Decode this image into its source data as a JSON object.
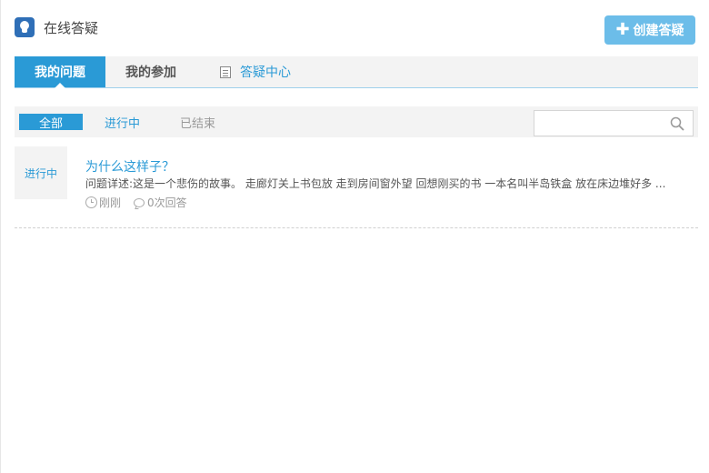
{
  "header": {
    "title": "在线答疑",
    "icon": "lightbulb-icon",
    "create_button_label": "创建答疑"
  },
  "tabs": [
    {
      "label": "我的问题",
      "active": true
    },
    {
      "label": "我的参加",
      "active": false
    },
    {
      "label": "答疑中心",
      "active": false,
      "icon": "document-icon"
    }
  ],
  "filters": [
    {
      "label": "全部",
      "active": true
    },
    {
      "label": "进行中",
      "active": false
    },
    {
      "label": "已结束",
      "active": false
    }
  ],
  "search": {
    "placeholder": "",
    "value": ""
  },
  "items": [
    {
      "status": "进行中",
      "title": "为什么这样子？",
      "description": "问题详述:这是一个悲伤的故事。 走廊灯关上书包放 走到房间窗外望 回想刚买的书 一本名叫半岛铁盒 放在床边堆好多 ...",
      "time": "刚刚",
      "answers": "0次回答"
    }
  ],
  "colors": {
    "accent": "#2a9ad6",
    "button": "#6cbde9"
  }
}
